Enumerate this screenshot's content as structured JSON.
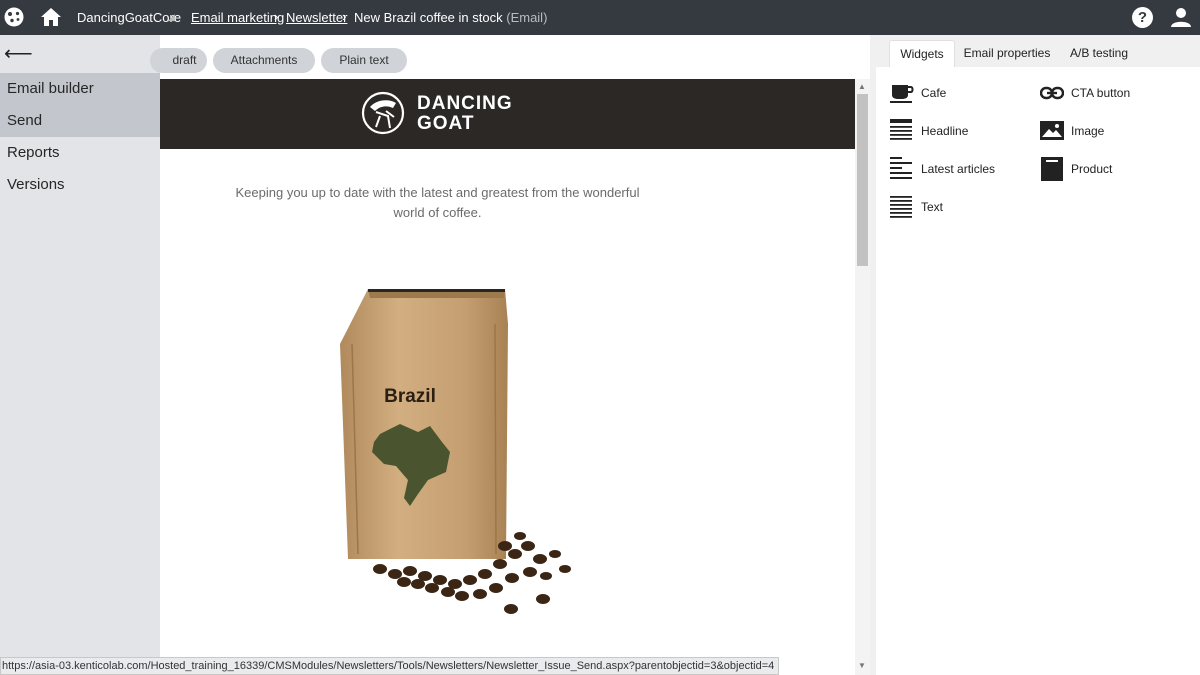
{
  "topbar": {
    "site_name": "DancingGoatCore",
    "breadcrumb": {
      "level1": "Email marketing",
      "level2": "Newsletter",
      "current": "New Brazil coffee in stock",
      "current_type": "(Email)"
    },
    "help_label": "?"
  },
  "sidebar": {
    "back_glyph": "⟵",
    "items": [
      {
        "label": "Email builder",
        "active": true
      },
      {
        "label": "Send",
        "active": true
      },
      {
        "label": "Reports",
        "active": false
      },
      {
        "label": "Versions",
        "active": false
      }
    ]
  },
  "editor_tabs": {
    "draft": "draft",
    "attachments": "Attachments",
    "plain_text": "Plain text"
  },
  "email": {
    "brand_line1": "DANCING",
    "brand_line2": "GOAT",
    "intro": "Keeping you up to date with the latest and greatest from the wonderful world of coffee.",
    "bag_label": "Brazil"
  },
  "right_panel": {
    "tabs": [
      "Widgets",
      "Email properties",
      "A/B testing"
    ],
    "active_tab": "Widgets",
    "widgets": [
      {
        "label": "Cafe",
        "icon": "cafe-icon"
      },
      {
        "label": "CTA button",
        "icon": "link-icon"
      },
      {
        "label": "Headline",
        "icon": "headline-icon"
      },
      {
        "label": "Image",
        "icon": "image-icon"
      },
      {
        "label": "Latest articles",
        "icon": "latest-articles-icon"
      },
      {
        "label": "Product",
        "icon": "product-icon"
      },
      {
        "label": "Text",
        "icon": "text-icon"
      }
    ]
  },
  "status_bar": {
    "url": "https://asia-03.kenticolab.com/Hosted_training_16339/CMSModules/Newsletters/Tools/Newsletters/Newsletter_Issue_Send.aspx?parentobjectid=3&objectid=4"
  },
  "colors": {
    "topbar": "#343a40",
    "sidebar": "#e2e4e7",
    "sidebar_active": "#c3c7cd",
    "email_header": "#2c2825",
    "pill": "#d0d3d8"
  }
}
